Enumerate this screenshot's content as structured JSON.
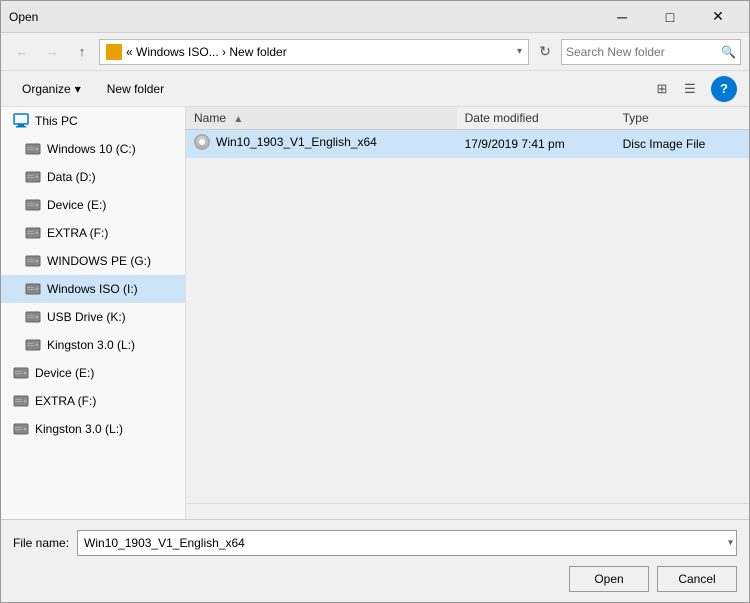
{
  "dialog": {
    "title": "Open",
    "close_btn": "✕",
    "min_btn": "─",
    "max_btn": "□"
  },
  "nav": {
    "back_label": "←",
    "forward_label": "→",
    "up_label": "↑",
    "address_path": "« Windows ISO... › New folder",
    "refresh_label": "↻",
    "search_placeholder": "Search New folder",
    "search_icon": "🔍"
  },
  "toolbar": {
    "organize_label": "Organize",
    "organize_arrow": "▾",
    "new_folder_label": "New folder",
    "view_grid_icon": "⊞",
    "view_list_icon": "☰",
    "help_label": "?"
  },
  "sidebar": {
    "items": [
      {
        "id": "this-pc",
        "label": "This PC",
        "icon": "monitor",
        "indent": 0
      },
      {
        "id": "windows10",
        "label": "Windows 10 (C:)",
        "icon": "hdd",
        "indent": 1
      },
      {
        "id": "data",
        "label": "Data (D:)",
        "icon": "hdd",
        "indent": 1
      },
      {
        "id": "device-e",
        "label": "Device (E:)",
        "icon": "hdd",
        "indent": 1
      },
      {
        "id": "extra-f",
        "label": "EXTRA (F:)",
        "icon": "hdd",
        "indent": 1
      },
      {
        "id": "windows-pe",
        "label": "WINDOWS PE (G:)",
        "icon": "hdd",
        "indent": 1
      },
      {
        "id": "windows-iso",
        "label": "Windows ISO (I:)",
        "icon": "hdd",
        "indent": 1,
        "selected": true
      },
      {
        "id": "usb-drive",
        "label": "USB Drive (K:)",
        "icon": "hdd",
        "indent": 1
      },
      {
        "id": "kingston",
        "label": "Kingston 3.0 (L:)",
        "icon": "hdd",
        "indent": 1
      },
      {
        "id": "device-e2",
        "label": "Device (E:)",
        "icon": "hdd",
        "indent": 0
      },
      {
        "id": "extra-f2",
        "label": "EXTRA (F:)",
        "icon": "hdd",
        "indent": 0
      },
      {
        "id": "kingston2",
        "label": "Kingston 3.0 (L:)",
        "icon": "hdd",
        "indent": 0
      }
    ]
  },
  "file_list": {
    "columns": [
      {
        "id": "name",
        "label": "Name",
        "sort_arrow": "▲"
      },
      {
        "id": "date_modified",
        "label": "Date modified"
      },
      {
        "id": "type",
        "label": "Type"
      }
    ],
    "rows": [
      {
        "name": "Win10_1903_V1_English_x64",
        "date_modified": "17/9/2019 7:41 pm",
        "type": "Disc Image File",
        "selected": true
      }
    ]
  },
  "footer": {
    "filename_label": "File name:",
    "filename_value": "Win10_1903_V1_English_x64",
    "open_label": "Open",
    "cancel_label": "Cancel"
  }
}
